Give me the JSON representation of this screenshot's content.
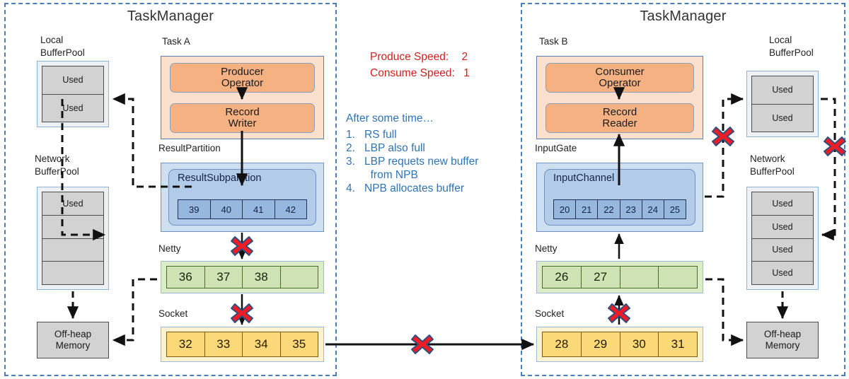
{
  "title_left": "TaskManager",
  "title_right": "TaskManager",
  "left": {
    "local_pool_caption": [
      "Local",
      "BufferPool"
    ],
    "local_pool_cells": [
      "Used",
      "Used"
    ],
    "network_pool_caption": [
      "Network",
      "BufferPool"
    ],
    "network_pool_cells": [
      "Used",
      "",
      "",
      ""
    ],
    "task_caption": "Task A",
    "operators": [
      {
        "line1": "Producer",
        "line2": "Operator"
      },
      {
        "line1": "Record",
        "line2": "Writer"
      }
    ],
    "result_partition_caption": "ResultPartition",
    "result_subpartition_label": "ResultSubpartition",
    "result_subpartition_slots": [
      "39",
      "40",
      "41",
      "42"
    ],
    "netty_caption": "Netty",
    "netty_slots": [
      "36",
      "37",
      "38",
      ""
    ],
    "socket_caption": "Socket",
    "socket_slots": [
      "32",
      "33",
      "34",
      "35"
    ],
    "offheap": [
      "Off-heap",
      "Memory"
    ]
  },
  "right": {
    "local_pool_caption": [
      "Local",
      "BufferPool"
    ],
    "local_pool_cells": [
      "Used",
      "Used"
    ],
    "network_pool_caption": [
      "Network",
      "BufferPool"
    ],
    "network_pool_cells": [
      "Used",
      "Used",
      "Used",
      "Used"
    ],
    "task_caption": "Task B",
    "operators": [
      {
        "line1": "Consumer",
        "line2": "Operator"
      },
      {
        "line1": "Record",
        "line2": "Reader"
      }
    ],
    "input_gate_caption": "InputGate",
    "input_channel_label": "InputChannel",
    "input_channel_slots": [
      "20",
      "21",
      "22",
      "23",
      "24",
      "25"
    ],
    "netty_caption": "Netty",
    "netty_slots": [
      "26",
      "27",
      "",
      ""
    ],
    "socket_caption": "Socket",
    "socket_slots": [
      "28",
      "29",
      "30",
      "31"
    ],
    "offheap": [
      "Off-heap",
      "Memory"
    ]
  },
  "annotations": {
    "produce_label": "Produce Speed:",
    "produce_value": "2",
    "consume_label": "Consume Speed:",
    "consume_value": "1",
    "after_time": "After some time…",
    "steps": [
      {
        "num": "1.",
        "text": "RS full"
      },
      {
        "num": "2.",
        "text": "LBP also full"
      },
      {
        "num": "3.",
        "text": "LBP requets new buffer"
      },
      {
        "num": "",
        "text": "  from NPB"
      },
      {
        "num": "4.",
        "text": "NPB allocates buffer"
      }
    ]
  },
  "colors": {
    "dashed_border": "#4a7ebb",
    "task_fill": "#fbe0cd",
    "operator_fill": "#f6b183",
    "partition_fill": "#cfdff2",
    "netty_fill": "#cfe3b4",
    "socket_fill": "#fbd978",
    "pool_cell": "#d2d2d2",
    "block_red": "#ee1c25",
    "note_blue": "#2e74b5",
    "speed_red": "#d11f1f"
  },
  "icons": {
    "block_marker": "red-x-block-icon"
  }
}
